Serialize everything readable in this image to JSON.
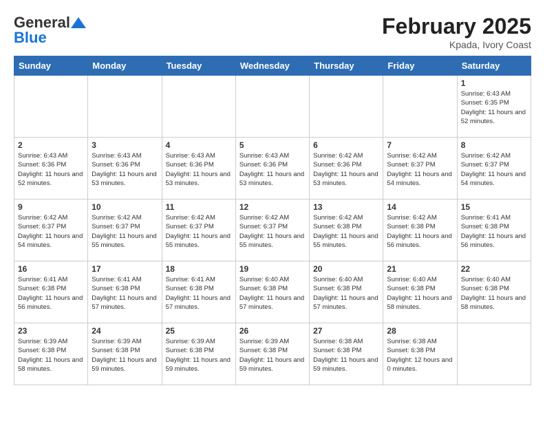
{
  "header": {
    "logo_general": "General",
    "logo_blue": "Blue",
    "title": "February 2025",
    "location": "Kpada, Ivory Coast"
  },
  "weekdays": [
    "Sunday",
    "Monday",
    "Tuesday",
    "Wednesday",
    "Thursday",
    "Friday",
    "Saturday"
  ],
  "weeks": [
    [
      {
        "day": "",
        "info": ""
      },
      {
        "day": "",
        "info": ""
      },
      {
        "day": "",
        "info": ""
      },
      {
        "day": "",
        "info": ""
      },
      {
        "day": "",
        "info": ""
      },
      {
        "day": "",
        "info": ""
      },
      {
        "day": "1",
        "info": "Sunrise: 6:43 AM\nSunset: 6:35 PM\nDaylight: 11 hours and 52 minutes."
      }
    ],
    [
      {
        "day": "2",
        "info": "Sunrise: 6:43 AM\nSunset: 6:36 PM\nDaylight: 11 hours and 52 minutes."
      },
      {
        "day": "3",
        "info": "Sunrise: 6:43 AM\nSunset: 6:36 PM\nDaylight: 11 hours and 53 minutes."
      },
      {
        "day": "4",
        "info": "Sunrise: 6:43 AM\nSunset: 6:36 PM\nDaylight: 11 hours and 53 minutes."
      },
      {
        "day": "5",
        "info": "Sunrise: 6:43 AM\nSunset: 6:36 PM\nDaylight: 11 hours and 53 minutes."
      },
      {
        "day": "6",
        "info": "Sunrise: 6:42 AM\nSunset: 6:36 PM\nDaylight: 11 hours and 53 minutes."
      },
      {
        "day": "7",
        "info": "Sunrise: 6:42 AM\nSunset: 6:37 PM\nDaylight: 11 hours and 54 minutes."
      },
      {
        "day": "8",
        "info": "Sunrise: 6:42 AM\nSunset: 6:37 PM\nDaylight: 11 hours and 54 minutes."
      }
    ],
    [
      {
        "day": "9",
        "info": "Sunrise: 6:42 AM\nSunset: 6:37 PM\nDaylight: 11 hours and 54 minutes."
      },
      {
        "day": "10",
        "info": "Sunrise: 6:42 AM\nSunset: 6:37 PM\nDaylight: 11 hours and 55 minutes."
      },
      {
        "day": "11",
        "info": "Sunrise: 6:42 AM\nSunset: 6:37 PM\nDaylight: 11 hours and 55 minutes."
      },
      {
        "day": "12",
        "info": "Sunrise: 6:42 AM\nSunset: 6:37 PM\nDaylight: 11 hours and 55 minutes."
      },
      {
        "day": "13",
        "info": "Sunrise: 6:42 AM\nSunset: 6:38 PM\nDaylight: 11 hours and 55 minutes."
      },
      {
        "day": "14",
        "info": "Sunrise: 6:42 AM\nSunset: 6:38 PM\nDaylight: 11 hours and 56 minutes."
      },
      {
        "day": "15",
        "info": "Sunrise: 6:41 AM\nSunset: 6:38 PM\nDaylight: 11 hours and 56 minutes."
      }
    ],
    [
      {
        "day": "16",
        "info": "Sunrise: 6:41 AM\nSunset: 6:38 PM\nDaylight: 11 hours and 56 minutes."
      },
      {
        "day": "17",
        "info": "Sunrise: 6:41 AM\nSunset: 6:38 PM\nDaylight: 11 hours and 57 minutes."
      },
      {
        "day": "18",
        "info": "Sunrise: 6:41 AM\nSunset: 6:38 PM\nDaylight: 11 hours and 57 minutes."
      },
      {
        "day": "19",
        "info": "Sunrise: 6:40 AM\nSunset: 6:38 PM\nDaylight: 11 hours and 57 minutes."
      },
      {
        "day": "20",
        "info": "Sunrise: 6:40 AM\nSunset: 6:38 PM\nDaylight: 11 hours and 57 minutes."
      },
      {
        "day": "21",
        "info": "Sunrise: 6:40 AM\nSunset: 6:38 PM\nDaylight: 11 hours and 58 minutes."
      },
      {
        "day": "22",
        "info": "Sunrise: 6:40 AM\nSunset: 6:38 PM\nDaylight: 11 hours and 58 minutes."
      }
    ],
    [
      {
        "day": "23",
        "info": "Sunrise: 6:39 AM\nSunset: 6:38 PM\nDaylight: 11 hours and 58 minutes."
      },
      {
        "day": "24",
        "info": "Sunrise: 6:39 AM\nSunset: 6:38 PM\nDaylight: 11 hours and 59 minutes."
      },
      {
        "day": "25",
        "info": "Sunrise: 6:39 AM\nSunset: 6:38 PM\nDaylight: 11 hours and 59 minutes."
      },
      {
        "day": "26",
        "info": "Sunrise: 6:39 AM\nSunset: 6:38 PM\nDaylight: 11 hours and 59 minutes."
      },
      {
        "day": "27",
        "info": "Sunrise: 6:38 AM\nSunset: 6:38 PM\nDaylight: 11 hours and 59 minutes."
      },
      {
        "day": "28",
        "info": "Sunrise: 6:38 AM\nSunset: 6:38 PM\nDaylight: 12 hours and 0 minutes."
      },
      {
        "day": "",
        "info": ""
      }
    ]
  ]
}
